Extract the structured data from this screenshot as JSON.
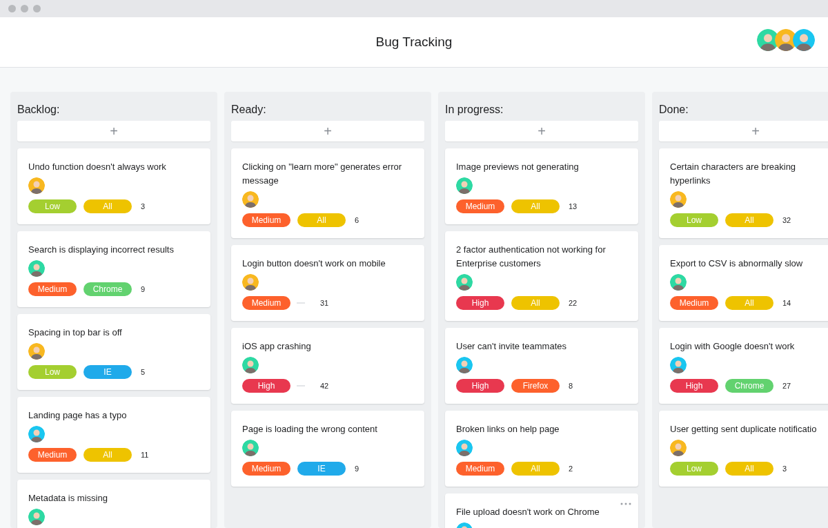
{
  "window": {
    "title": "Bug Tracking"
  },
  "header_avatars": [
    {
      "color": "#2ed9a3"
    },
    {
      "color": "#f8b820"
    },
    {
      "color": "#1ac6f0"
    }
  ],
  "columns": [
    {
      "title": "Backlog:",
      "add_label": "+",
      "cards": [
        {
          "title": "Undo function doesn't always work",
          "avatar": {
            "color": "#f8b820"
          },
          "tags": [
            {
              "kind": "label",
              "label": "Low",
              "color": "#a4cf30"
            },
            {
              "kind": "label",
              "label": "All",
              "color": "#eec300"
            }
          ],
          "count": "3"
        },
        {
          "title": "Search is displaying incorrect results",
          "avatar": {
            "color": "#2ed9a3"
          },
          "tags": [
            {
              "kind": "label",
              "label": "Medium",
              "color": "#fd612c"
            },
            {
              "kind": "label",
              "label": "Chrome",
              "color": "#62d26f"
            }
          ],
          "count": "9"
        },
        {
          "title": "Spacing in top bar is off",
          "avatar": {
            "color": "#f8b820"
          },
          "tags": [
            {
              "kind": "label",
              "label": "Low",
              "color": "#a4cf30"
            },
            {
              "kind": "label",
              "label": "IE",
              "color": "#20aaea"
            }
          ],
          "count": "5"
        },
        {
          "title": "Landing page has a typo",
          "avatar": {
            "color": "#1ac6f0"
          },
          "tags": [
            {
              "kind": "label",
              "label": "Medium",
              "color": "#fd612c"
            },
            {
              "kind": "label",
              "label": "All",
              "color": "#eec300"
            }
          ],
          "count": "11"
        },
        {
          "title": "Metadata is missing",
          "avatar": {
            "color": "#2ed9a3"
          }
        }
      ]
    },
    {
      "title": "Ready:",
      "add_label": "+",
      "cards": [
        {
          "title": "Clicking on \"learn more\" generates error message",
          "avatar": {
            "color": "#f8b820"
          },
          "tags": [
            {
              "kind": "label",
              "label": "Medium",
              "color": "#fd612c"
            },
            {
              "kind": "label",
              "label": "All",
              "color": "#eec300"
            }
          ],
          "count": "6"
        },
        {
          "title": "Login button doesn't work on mobile",
          "avatar": {
            "color": "#f8b820"
          },
          "tags": [
            {
              "kind": "label",
              "label": "Medium",
              "color": "#fd612c"
            },
            {
              "kind": "blank"
            }
          ],
          "count": "31"
        },
        {
          "title": "iOS app crashing",
          "avatar": {
            "color": "#2ed9a3"
          },
          "tags": [
            {
              "kind": "label",
              "label": "High",
              "color": "#e8384f"
            },
            {
              "kind": "blank"
            }
          ],
          "count": "42"
        },
        {
          "title": "Page is loading the wrong content",
          "avatar": {
            "color": "#2ed9a3"
          },
          "tags": [
            {
              "kind": "label",
              "label": "Medium",
              "color": "#fd612c"
            },
            {
              "kind": "label",
              "label": "IE",
              "color": "#20aaea"
            }
          ],
          "count": "9"
        }
      ]
    },
    {
      "title": "In progress:",
      "add_label": "+",
      "cards": [
        {
          "title": "Image previews not generating",
          "avatar": {
            "color": "#2ed9a3"
          },
          "tags": [
            {
              "kind": "label",
              "label": "Medium",
              "color": "#fd612c"
            },
            {
              "kind": "label",
              "label": "All",
              "color": "#eec300"
            }
          ],
          "count": "13"
        },
        {
          "title": "2 factor authentication not working for Enterprise customers",
          "avatar": {
            "color": "#2ed9a3"
          },
          "tags": [
            {
              "kind": "label",
              "label": "High",
              "color": "#e8384f"
            },
            {
              "kind": "label",
              "label": "All",
              "color": "#eec300"
            }
          ],
          "count": "22"
        },
        {
          "title": "User can't invite teammates",
          "avatar": {
            "color": "#1ac6f0"
          },
          "tags": [
            {
              "kind": "label",
              "label": "High",
              "color": "#e8384f"
            },
            {
              "kind": "label",
              "label": "Firefox",
              "color": "#fd612c"
            }
          ],
          "count": "8"
        },
        {
          "title": "Broken links on help page",
          "avatar": {
            "color": "#1ac6f0"
          },
          "tags": [
            {
              "kind": "label",
              "label": "Medium",
              "color": "#fd612c"
            },
            {
              "kind": "label",
              "label": "All",
              "color": "#eec300"
            }
          ],
          "count": "2"
        },
        {
          "title": "File upload doesn't work on Chrome",
          "avatar": {
            "color": "#1ac6f0"
          },
          "menu": true
        }
      ]
    },
    {
      "title": "Done:",
      "add_label": "+",
      "cards": [
        {
          "title": "Certain characters are breaking hyperlinks",
          "avatar": {
            "color": "#f8b820"
          },
          "tags": [
            {
              "kind": "label",
              "label": "Low",
              "color": "#a4cf30"
            },
            {
              "kind": "label",
              "label": "All",
              "color": "#eec300"
            }
          ],
          "count": "32"
        },
        {
          "title": "Export to CSV is abnormally slow",
          "avatar": {
            "color": "#2ed9a3"
          },
          "tags": [
            {
              "kind": "label",
              "label": "Medium",
              "color": "#fd612c"
            },
            {
              "kind": "label",
              "label": "All",
              "color": "#eec300"
            }
          ],
          "count": "14"
        },
        {
          "title": "Login with Google doesn't work",
          "avatar": {
            "color": "#1ac6f0"
          },
          "tags": [
            {
              "kind": "label",
              "label": "High",
              "color": "#e8384f"
            },
            {
              "kind": "label",
              "label": "Chrome",
              "color": "#62d26f"
            }
          ],
          "count": "27"
        },
        {
          "title": "User getting sent duplicate notificatio",
          "avatar": {
            "color": "#f8b820"
          },
          "tags": [
            {
              "kind": "label",
              "label": "Low",
              "color": "#a4cf30"
            },
            {
              "kind": "label",
              "label": "All",
              "color": "#eec300"
            }
          ],
          "count": "3"
        }
      ]
    }
  ]
}
